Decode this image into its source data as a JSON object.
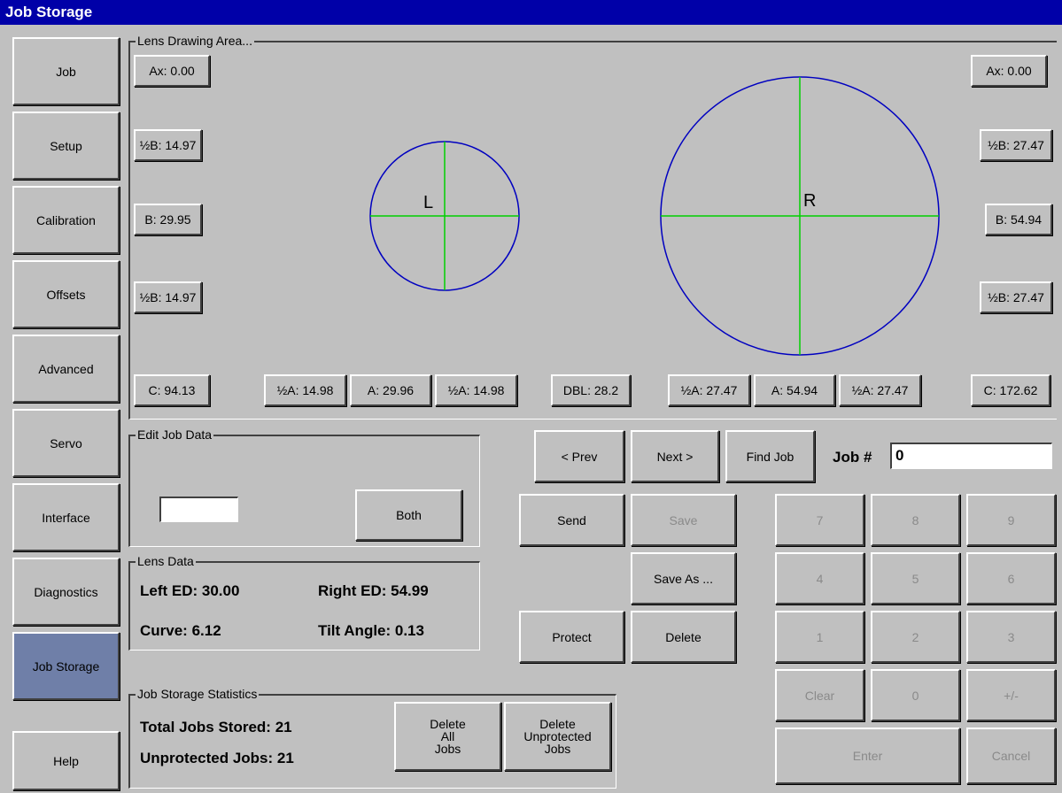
{
  "window": {
    "title": "Job Storage"
  },
  "sidebar": {
    "items": [
      {
        "label": "Job"
      },
      {
        "label": "Setup"
      },
      {
        "label": "Calibration"
      },
      {
        "label": "Offsets"
      },
      {
        "label": "Advanced"
      },
      {
        "label": "Servo"
      },
      {
        "label": "Interface"
      },
      {
        "label": "Diagnostics"
      },
      {
        "label": "Job Storage",
        "active": true
      },
      {
        "label": "Help"
      }
    ]
  },
  "lens_area": {
    "label": "Lens Drawing Area...",
    "left_side": {
      "ax": "Ax: 0.00",
      "half_b_top": "½B: 14.97",
      "b": "B: 29.95",
      "half_b_bottom": "½B: 14.97",
      "c": "C: 94.13"
    },
    "right_side": {
      "ax": "Ax: 0.00",
      "half_b_top": "½B: 27.47",
      "b": "B: 54.94",
      "half_b_bottom": "½B: 27.47",
      "c": "C: 172.62"
    },
    "left_bottom": {
      "half_a_1": "½A: 14.98",
      "a": "A: 29.96",
      "half_a_2": "½A: 14.98"
    },
    "dbl": "DBL: 28.2",
    "right_bottom": {
      "half_a_1": "½A: 27.47",
      "a": "A: 54.94",
      "half_a_2": "½A: 27.47"
    },
    "left_lens_letter": "L",
    "right_lens_letter": "R",
    "circle_color": "#0000c0",
    "cross_color": "#00d000"
  },
  "edit_job": {
    "label": "Edit Job Data",
    "input_value": "",
    "both_label": "Both"
  },
  "lens_data": {
    "label": "Lens Data",
    "left_ed": "Left ED: 30.00",
    "right_ed": "Right ED: 54.99",
    "curve": "Curve: 6.12",
    "tilt": "Tilt Angle: 0.13"
  },
  "stats": {
    "label": "Job Storage Statistics",
    "total": "Total Jobs Stored:  21",
    "unprotected": "Unprotected Jobs:  21",
    "delete_all_1": "Delete",
    "delete_all_2": "All",
    "delete_all_3": "Jobs",
    "delete_unprot_1": "Delete",
    "delete_unprot_2": "Unprotected",
    "delete_unprot_3": "Jobs"
  },
  "nav": {
    "prev": "< Prev",
    "next": "Next >",
    "find": "Find Job",
    "job_label": "Job #",
    "job_value": "0"
  },
  "actions": {
    "send": "Send",
    "save": "Save",
    "save_as": "Save As ...",
    "protect": "Protect",
    "delete": "Delete"
  },
  "keypad": {
    "k7": "7",
    "k8": "8",
    "k9": "9",
    "k4": "4",
    "k5": "5",
    "k6": "6",
    "k1": "1",
    "k2": "2",
    "k3": "3",
    "clear": "Clear",
    "k0": "0",
    "plusminus": "+/-",
    "enter": "Enter",
    "cancel": "Cancel"
  }
}
